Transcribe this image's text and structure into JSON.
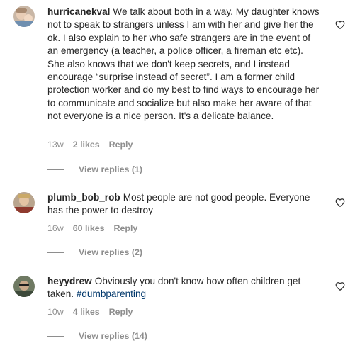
{
  "comments": [
    {
      "username": "hurricanekval",
      "text": "We talk about both in a way. My daughter knows not to speak to strangers unless I am with her and give her the ok. I also explain to her who safe strangers are in the event of an emergency (a teacher, a police officer, a fireman etc etc). She also knows that we don't keep secrets, and I instead encourage “surprise instead of secret”. I am a former child protection worker and do my best to find ways to encourage her to communicate and socialize but also make her aware of that not everyone is a nice person. It's a delicate balance.",
      "time": "13w",
      "likes": "2 likes",
      "reply": "Reply",
      "view_replies": "View replies (1)"
    },
    {
      "username": "plumb_bob_rob",
      "text": "Most people are not good people. Everyone has the power to destroy",
      "time": "16w",
      "likes": "60 likes",
      "reply": "Reply",
      "view_replies": "View replies (2)"
    },
    {
      "username": "heyydrew",
      "text": "Obviously you don't know how often children get taken.",
      "hashtag": "#dumbparenting",
      "time": "10w",
      "likes": "4 likes",
      "reply": "Reply",
      "view_replies": "View replies (14)"
    }
  ],
  "icons": {
    "like": "heart-outline-icon"
  },
  "colors": {
    "text": "#262626",
    "secondary": "#8e8e8e",
    "hashtag": "#00376b"
  }
}
